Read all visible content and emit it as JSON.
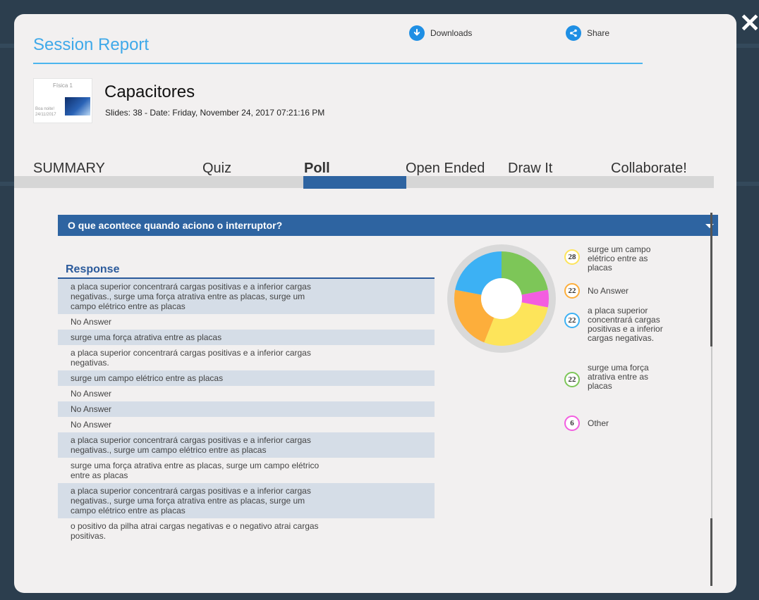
{
  "dialog": {
    "close_label": "✕"
  },
  "header": {
    "title": "Session Report",
    "downloads_label": "Downloads",
    "share_label": "Share"
  },
  "presentation": {
    "thumb_title": "Física 1",
    "thumb_caption_1": "Boa noite!",
    "thumb_caption_2": "24/11/2017",
    "title": "Capacitores",
    "meta": "Slides: 38 - Date: Friday, November 24, 2017 07:21:16 PM"
  },
  "tabs": [
    {
      "label": "SUMMARY"
    },
    {
      "label": "Quiz"
    },
    {
      "label": "Poll"
    },
    {
      "label": "Open Ended"
    },
    {
      "label": "Draw It"
    },
    {
      "label": "Collaborate!"
    }
  ],
  "active_tab": "Poll",
  "question": {
    "text": "O que acontece quando aciono o interruptor?"
  },
  "responses": {
    "header": "Response",
    "rows": [
      {
        "text": "a placa superior concentrará cargas positivas e a inferior cargas negativas., surge uma força atrativa entre as placas, surge um campo elétrico entre as placas"
      },
      {
        "text": "No Answer"
      },
      {
        "text": "surge uma força atrativa entre as placas"
      },
      {
        "text": "a placa superior concentrará cargas positivas e a inferior cargas negativas."
      },
      {
        "text": "surge um campo elétrico entre as placas"
      },
      {
        "text": "No Answer"
      },
      {
        "text": "No Answer"
      },
      {
        "text": "No Answer"
      },
      {
        "text": "a placa superior concentrará cargas positivas e a inferior cargas negativas., surge um campo elétrico entre as placas"
      },
      {
        "text": "surge uma força atrativa entre as placas, surge um campo elétrico entre as placas"
      },
      {
        "text": "a placa superior concentrará cargas positivas e a inferior cargas negativas., surge uma força atrativa entre as placas, surge um campo elétrico entre as placas"
      },
      {
        "text": "o positivo da pilha atrai cargas negativas e o negativo atrai cargas positivas."
      }
    ]
  },
  "chart_data": {
    "type": "pie",
    "categories": [
      "surge um campo elétrico entre as placas",
      "No Answer",
      "a placa superior concentrará cargas positivas e a inferior cargas negativas.",
      "surge uma força atrativa entre as placas",
      "Other"
    ],
    "values": [
      28,
      22,
      22,
      22,
      6
    ],
    "colors": [
      "#fde45a",
      "#fdae3b",
      "#3cb1f4",
      "#7dc658",
      "#f35ee0"
    ],
    "legend_position": "right"
  }
}
